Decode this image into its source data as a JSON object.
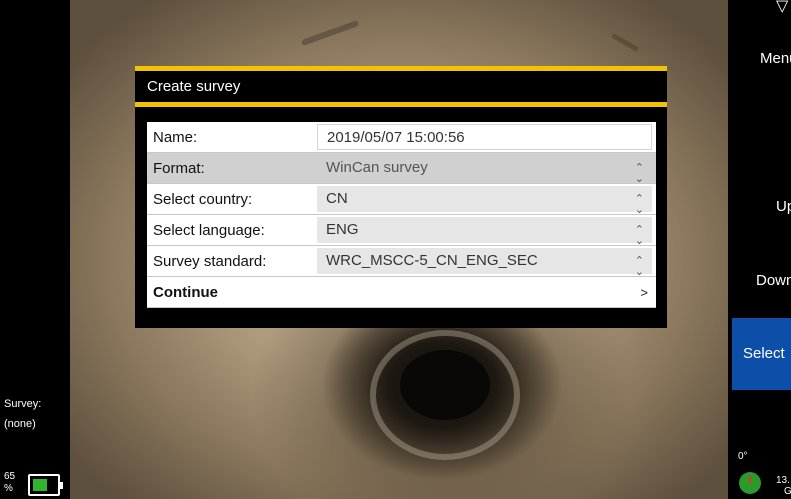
{
  "left_panel": {
    "survey_label": "Survey:",
    "survey_value": "(none)",
    "battery_percent": "65",
    "battery_unit": "%",
    "battery_level": 0.65
  },
  "right_panel": {
    "menu_label": "Menu",
    "up_label": "Up",
    "down_label": "Down",
    "select_label": "Select",
    "angle": "0°",
    "storage_value": "13.",
    "storage_unit": "G"
  },
  "dialog": {
    "title": "Create survey",
    "fields": [
      {
        "label": "Name:",
        "value": "2019/05/07 15:00:56"
      },
      {
        "label": "Format:",
        "value": "WinCan survey"
      },
      {
        "label": "Select country:",
        "value": "CN"
      },
      {
        "label": "Select language:",
        "value": "ENG"
      },
      {
        "label": "Survey standard:",
        "value": "WRC_MSCC-5_CN_ENG_SEC"
      }
    ],
    "continue_label": "Continue",
    "continue_chevron": ">"
  },
  "colors": {
    "accent_yellow": "#f2c300",
    "select_blue": "#0d4fa8",
    "battery_green": "#2fb52f"
  }
}
